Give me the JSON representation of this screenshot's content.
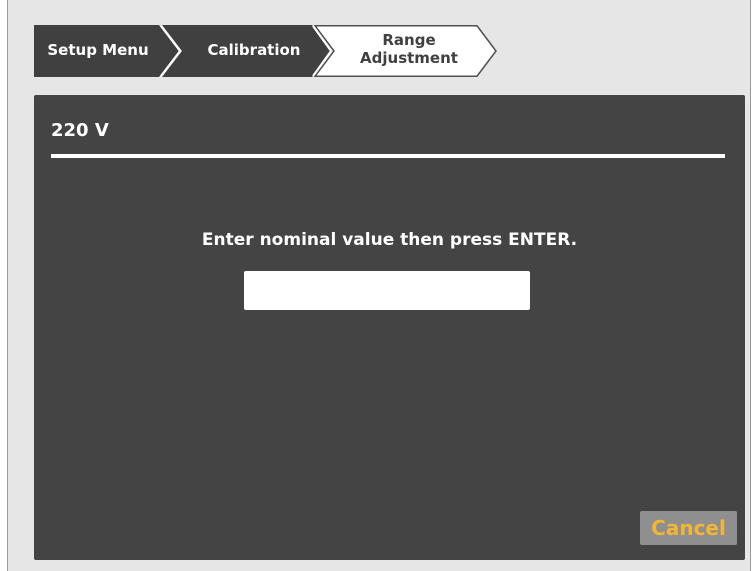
{
  "breadcrumb": {
    "items": [
      {
        "label": "Setup Menu"
      },
      {
        "label": "Calibration"
      },
      {
        "label_line1": "Range",
        "label_line2": "Adjustment"
      }
    ]
  },
  "panel": {
    "title": "220 V",
    "prompt": "Enter nominal value then press ENTER.",
    "input_value": "",
    "cancel_label": "Cancel"
  },
  "colors": {
    "panel_bg": "#434443",
    "crumb_dark": "#3f403f",
    "cancel_text": "#f3b534",
    "cancel_bg": "#8f8f8f",
    "frame_bg": "#e6e6e6"
  }
}
